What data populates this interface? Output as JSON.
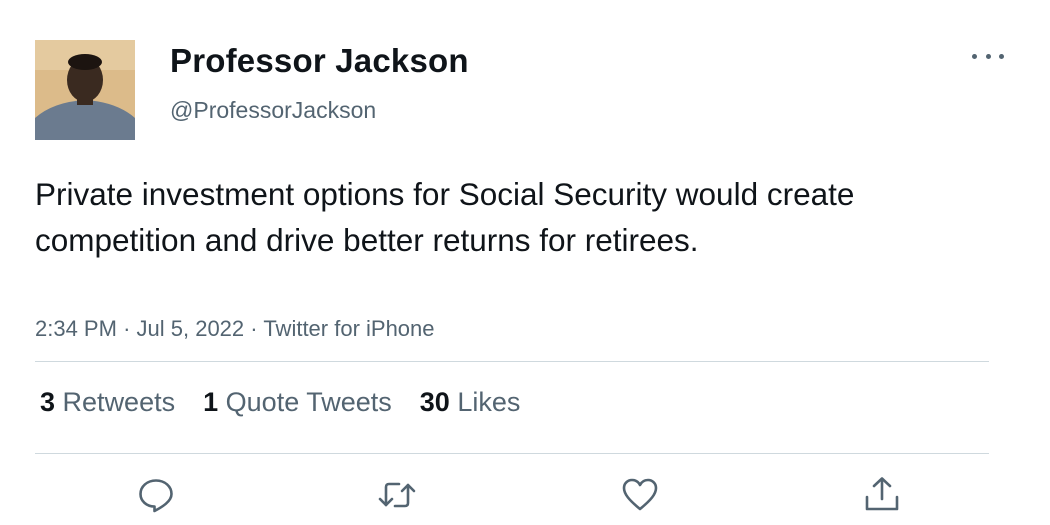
{
  "author": {
    "display_name": "Professor Jackson",
    "handle": "@ProfessorJackson",
    "avatar_icon": "profile-photo"
  },
  "tweet": {
    "text": "Private investment options for Social Security would create competition and drive better returns for retirees.",
    "time": "2:34 PM",
    "date": "Jul 5, 2022",
    "source": "Twitter for iPhone"
  },
  "stats": {
    "retweets_count": "3",
    "retweets_label": "Retweets",
    "quotes_count": "1",
    "quotes_label": "Quote Tweets",
    "likes_count": "30",
    "likes_label": "Likes"
  },
  "actions": [
    "reply-icon",
    "retweet-icon",
    "like-icon",
    "share-icon"
  ],
  "colors": {
    "text_primary": "#0f1419",
    "text_secondary": "#536471",
    "divider": "#cfd9de"
  }
}
